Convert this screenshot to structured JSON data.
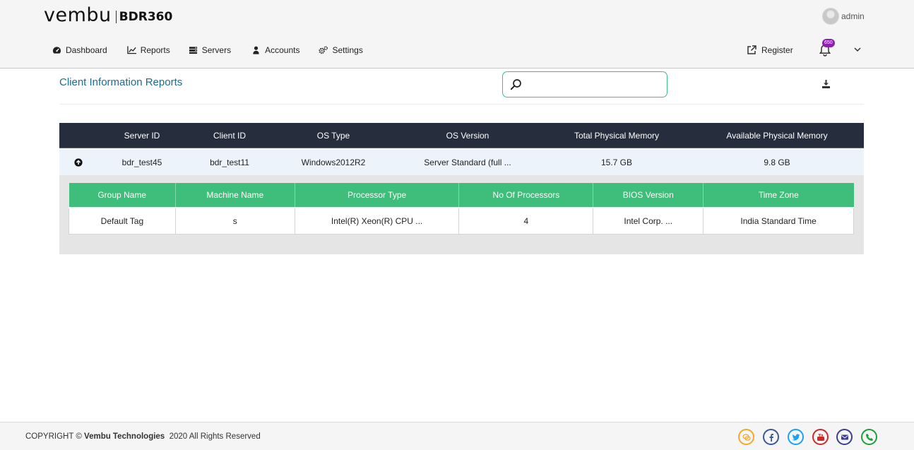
{
  "brand": {
    "word": "vembu",
    "product": "BDR360"
  },
  "user": {
    "name": "admin"
  },
  "nav": [
    {
      "label": "Dashboard",
      "icon": "dashboard-icon"
    },
    {
      "label": "Reports",
      "icon": "chart-icon"
    },
    {
      "label": "Servers",
      "icon": "server-icon"
    },
    {
      "label": "Accounts",
      "icon": "user-icon"
    },
    {
      "label": "Settings",
      "icon": "gears-icon"
    }
  ],
  "header_right": {
    "register_label": "Register",
    "notification_count": "650"
  },
  "page": {
    "title": "Client Information Reports",
    "search_placeholder": ""
  },
  "main_table": {
    "columns": [
      "Server ID",
      "Client ID",
      "OS Type",
      "OS Version",
      "Total Physical Memory",
      "Available Physical Memory"
    ],
    "rows": [
      [
        "bdr_test45",
        "bdr_test11",
        "Windows2012R2",
        "Server Standard (full ...",
        "15.7 GB",
        "9.8 GB"
      ]
    ]
  },
  "detail_table": {
    "columns": [
      "Group Name",
      "Machine Name",
      "Processor Type",
      "No Of Processors",
      "BIOS Version",
      "Time Zone"
    ],
    "rows": [
      [
        "Default Tag",
        "s",
        "Intel(R) Xeon(R) CPU ...",
        "4",
        "Intel Corp. ...",
        "India Standard Time"
      ]
    ]
  },
  "footer": {
    "copyright_prefix": "COPYRIGHT ©",
    "company": "Vembu Technologies",
    "suffix": "2020 All Rights Reserved",
    "social": [
      {
        "icon": "chat-icon",
        "color": "#f0a92e"
      },
      {
        "icon": "facebook-icon",
        "color": "#3b5998"
      },
      {
        "icon": "twitter-icon",
        "color": "#1da1f2"
      },
      {
        "icon": "youtube-icon",
        "color": "#cc2a2a"
      },
      {
        "icon": "email-icon",
        "color": "#3a3f8f"
      },
      {
        "icon": "phone-icon",
        "color": "#1e9e3a"
      }
    ]
  },
  "colors": {
    "accent": "#3fbd7a",
    "title": "#1d6b8d",
    "table_head": "#262e3d",
    "badge": "#8e1fb3"
  }
}
